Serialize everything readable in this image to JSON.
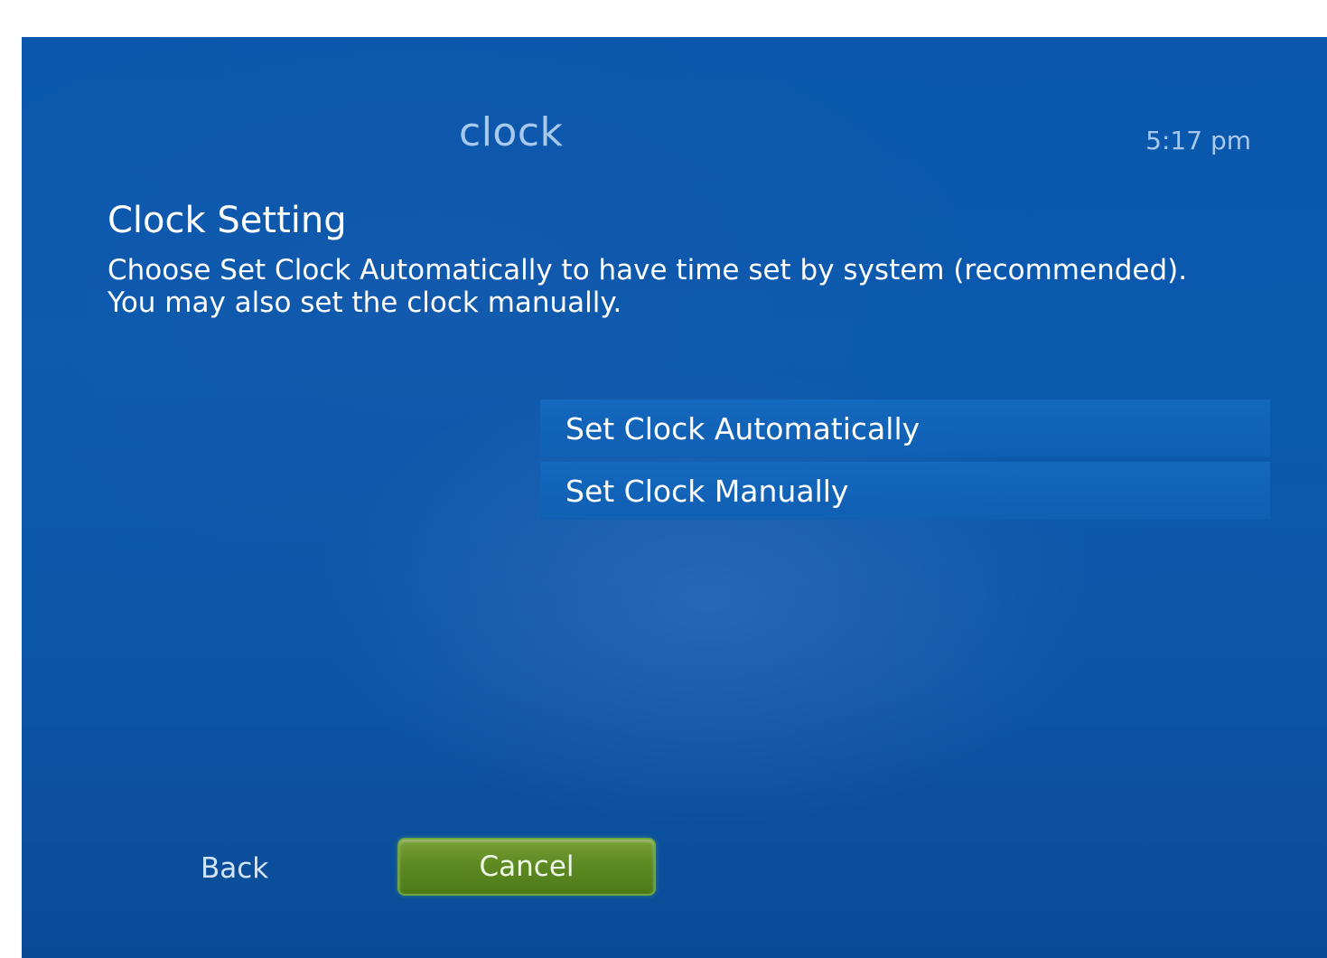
{
  "header": {
    "title": "clock",
    "time": "5:17 pm"
  },
  "content": {
    "title": "Clock Setting",
    "description_line1": "Choose Set Clock Automatically to have time set by system (recommended).",
    "description_line2": "You may also set the clock manually."
  },
  "options": [
    {
      "label": "Set Clock Automatically"
    },
    {
      "label": "Set Clock Manually"
    }
  ],
  "footer": {
    "back_label": "Back",
    "cancel_label": "Cancel"
  },
  "colors": {
    "background": "#0b5aae",
    "option_bar": "#1469be",
    "cancel_button": "#5d8a22",
    "header_text": "#a9c9ec"
  }
}
